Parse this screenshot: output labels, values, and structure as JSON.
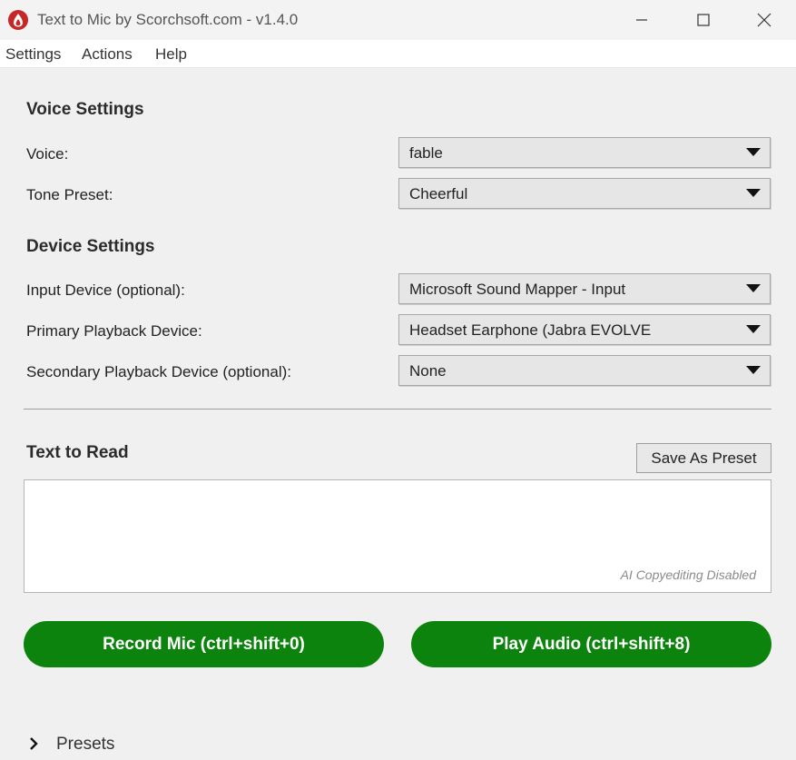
{
  "window": {
    "title": "Text to Mic by Scorchsoft.com - v1.4.0",
    "app_icon": "scorchsoft-flame-icon",
    "controls": [
      "minimize-icon",
      "maximize-icon",
      "close-icon"
    ]
  },
  "menu": {
    "items": [
      "Settings",
      "Actions",
      "Help"
    ]
  },
  "voice_settings": {
    "title": "Voice Settings",
    "voice": {
      "label": "Voice:",
      "value": "fable"
    },
    "tone_preset": {
      "label": "Tone Preset:",
      "value": "Cheerful"
    }
  },
  "device_settings": {
    "title": "Device Settings",
    "input_device": {
      "label": "Input Device (optional):",
      "value": "Microsoft Sound Mapper - Input"
    },
    "primary_playback": {
      "label": "Primary Playback Device:",
      "value": "Headset Earphone (Jabra EVOLVE"
    },
    "secondary_playback": {
      "label": "Secondary Playback Device (optional):",
      "value": "None"
    }
  },
  "text_to_read": {
    "title": "Text to Read",
    "save_preset_label": "Save As Preset",
    "value": "",
    "hint": "AI Copyediting Disabled"
  },
  "actions": {
    "record_label": "Record Mic (ctrl+shift+0)",
    "play_label": "Play Audio (ctrl+shift+8)",
    "button_color": "#0c830c"
  },
  "presets": {
    "label": "Presets",
    "expanded": false
  }
}
